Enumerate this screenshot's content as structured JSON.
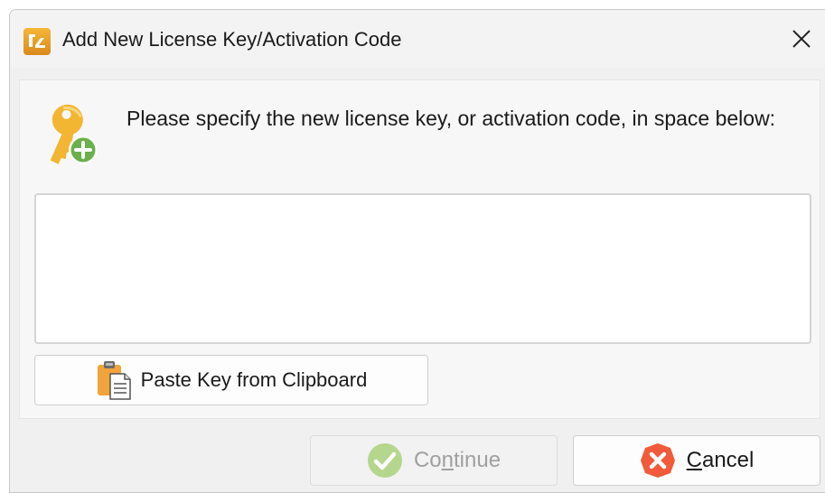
{
  "window": {
    "title": "Add New License Key/Activation Code"
  },
  "content": {
    "instructions": "Please specify the new license key, or activation code, in space below:",
    "license_value": "",
    "paste_button_label": "Paste Key from Clipboard"
  },
  "footer": {
    "continue": {
      "before": "Co",
      "mnemonic": "n",
      "after": "tinue",
      "enabled": false
    },
    "cancel": {
      "before": "",
      "mnemonic": "C",
      "after": "ancel",
      "enabled": true
    }
  },
  "icons": {
    "app": "app-logo-icon",
    "close": "close-icon",
    "key_add": "key-add-icon",
    "clipboard": "clipboard-icon",
    "continue": "check-circle-icon",
    "cancel": "x-circle-icon"
  },
  "colors": {
    "key_gold": "#f2b632",
    "add_green": "#6ab04c",
    "check_green": "#8cc34a",
    "cancel_orange": "#f15a3a",
    "disabled_text": "#a0a0a0"
  }
}
